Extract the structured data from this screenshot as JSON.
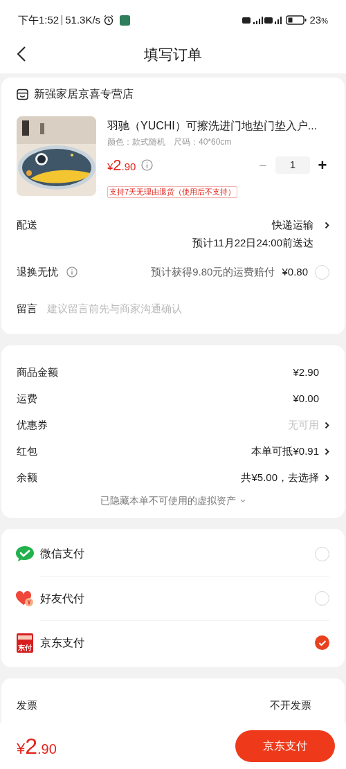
{
  "status_bar": {
    "time": "下午1:52",
    "speed": "51.3K/s",
    "battery": "23",
    "battery_unit": "%"
  },
  "header": {
    "title": "填写订单"
  },
  "shop": {
    "name": "新强家居京喜专营店"
  },
  "product": {
    "title": "羽驰（YUCHI）可擦洗进门地垫门垫入户...",
    "spec_color": "颜色：款式随机",
    "spec_size": "尺码：40*60cm",
    "price_symbol": "¥",
    "price_int": "2",
    "price_dec": ".90",
    "quantity": "1",
    "minus": "−",
    "plus": "+",
    "return_tag": "支持7天无理由退货（使用后不支持）"
  },
  "delivery": {
    "label": "配送",
    "method": "快递运输",
    "eta": "预计11月22日24:00前送达"
  },
  "worry_free": {
    "label": "退换无忧",
    "desc": "预计获得9.80元的运费赔付",
    "price": "¥0.80",
    "checked": false
  },
  "note": {
    "label": "留言",
    "placeholder": "建议留言前先与商家沟通确认"
  },
  "summary": [
    {
      "label": "商品金额",
      "value": "¥2.90",
      "muted": false,
      "arrow": false
    },
    {
      "label": "运费",
      "value": "¥0.00",
      "muted": false,
      "arrow": false
    },
    {
      "label": "优惠券",
      "value": "无可用",
      "muted": true,
      "arrow": true
    },
    {
      "label": "红包",
      "value": "本单可抵¥0.91",
      "muted": false,
      "arrow": true
    },
    {
      "label": "余额",
      "value": "共¥5.00，去选择",
      "muted": false,
      "arrow": true
    }
  ],
  "hidden_assets": "已隐藏本单不可使用的虚拟资产",
  "payment": [
    {
      "kind": "wechat",
      "label": "微信支付",
      "selected": false
    },
    {
      "kind": "friend",
      "label": "好友代付",
      "selected": false
    },
    {
      "kind": "jd",
      "label": "京东支付",
      "icon_text": "东付",
      "selected": true
    }
  ],
  "invoice": {
    "label": "发票",
    "value": "不开发票"
  },
  "bottom": {
    "price_symbol": "¥",
    "price_int": "2",
    "price_dec": ".90",
    "button": "京东支付"
  }
}
